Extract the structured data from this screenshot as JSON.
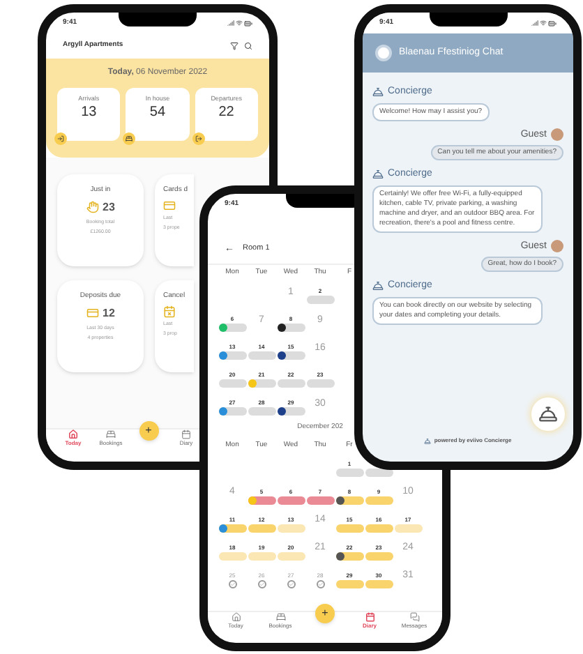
{
  "dashboard_phone": {
    "time": "9:41",
    "title": "Argyll Apartments",
    "date_line": "**Today,** 06 November 2022",
    "stats": [
      {
        "label": "Arrivals",
        "value": "13",
        "kind": "arrivals"
      },
      {
        "label": "In house",
        "value": "54",
        "kind": "inhouse"
      },
      {
        "label": "Departures",
        "value": "22",
        "kind": "departures"
      }
    ],
    "cards": [
      {
        "label": "Just in",
        "value": "23",
        "kind": "justin",
        "line1": "Booking total",
        "line2": "£1260.00"
      },
      {
        "label": "Cards d",
        "kind": "cards",
        "line1": "Last",
        "line2": "3 prope"
      },
      {
        "label": "Deposits due",
        "value": "12",
        "kind": "deposits",
        "line1": "Last 30 days",
        "line2": "4 properties"
      },
      {
        "label": "Cancel",
        "kind": "cancel",
        "line1": "Last",
        "line2": "3 prop"
      }
    ],
    "nav": [
      {
        "label": "Today",
        "kind": "today",
        "selected": true
      },
      {
        "label": "Bookings",
        "kind": "bookings",
        "selected": false
      },
      {
        "label": "Diary",
        "kind": "diary",
        "selected": false
      }
    ],
    "add_button": "+"
  },
  "diary_phone": {
    "time": "9:41",
    "back": "←",
    "title": "Room 1",
    "november": {
      "weekdays": [
        "Mon",
        "Tue",
        "Wed",
        "Thu",
        "F"
      ],
      "weeks": [
        [
          {
            "kind": "blank"
          },
          {
            "kind": "blank"
          },
          {
            "kind": "free",
            "day": "1"
          },
          {
            "kind": "booked",
            "day": "2",
            "color": "#dcdcdc"
          }
        ],
        [
          {
            "kind": "booked",
            "day": "6",
            "color": "#dcdcdc",
            "guest": {
              "color": "#1fbf6a"
            }
          },
          {
            "kind": "free",
            "day": "7"
          },
          {
            "kind": "booked",
            "day": "8",
            "color": "#dcdcdc",
            "guest": {
              "color": "#222222"
            }
          },
          {
            "kind": "free",
            "day": "9"
          }
        ],
        [
          {
            "kind": "booked",
            "day": "13",
            "color": "#dcdcdc",
            "guest": {
              "color": "#2a8fd8"
            }
          },
          {
            "kind": "booked",
            "day": "14",
            "color": "#dcdcdc"
          },
          {
            "kind": "booked",
            "day": "15",
            "color": "#dcdcdc",
            "guest": {
              "color": "#1e3f8a"
            }
          },
          {
            "kind": "free",
            "day": "16"
          }
        ],
        [
          {
            "kind": "booked",
            "day": "20",
            "color": "#dcdcdc"
          },
          {
            "kind": "booked",
            "day": "21",
            "color": "#dcdcdc",
            "guest": {
              "color": "#f5c518"
            }
          },
          {
            "kind": "booked",
            "day": "22",
            "color": "#dcdcdc"
          },
          {
            "kind": "booked",
            "day": "23",
            "color": "#dcdcdc"
          }
        ],
        [
          {
            "kind": "booked",
            "day": "27",
            "color": "#dcdcdc",
            "guest": {
              "color": "#2a8fd8"
            }
          },
          {
            "kind": "booked",
            "day": "28",
            "color": "#dcdcdc"
          },
          {
            "kind": "booked",
            "day": "29",
            "color": "#dcdcdc",
            "guest": {
              "color": "#1e3f8a"
            }
          },
          {
            "kind": "free",
            "day": "30"
          }
        ]
      ]
    },
    "december": {
      "label": "December 202",
      "weekdays": [
        "Mon",
        "Tue",
        "Wed",
        "Thu",
        "Fr"
      ],
      "weeks": [
        [
          {
            "kind": "blank"
          },
          {
            "kind": "blank"
          },
          {
            "kind": "blank"
          },
          {
            "kind": "blank"
          },
          {
            "kind": "booked",
            "day": "1",
            "color": "#dcdcdc"
          },
          {
            "kind": "booked",
            "color": "#dcdcdc"
          },
          {
            "kind": "blank"
          }
        ],
        [
          {
            "kind": "free",
            "day": "4"
          },
          {
            "kind": "booked",
            "day": "5",
            "color": "#e98a95",
            "guest": {
              "color": "#f5c518"
            }
          },
          {
            "kind": "booked",
            "day": "6",
            "color": "#e98a95"
          },
          {
            "kind": "booked",
            "day": "7",
            "color": "#e98a95"
          },
          {
            "kind": "booked",
            "day": "8",
            "color": "#f9d36b",
            "guest": {
              "color": "#555555"
            }
          },
          {
            "kind": "booked",
            "day": "9",
            "color": "#f9d36b"
          },
          {
            "kind": "free",
            "day": "10"
          }
        ],
        [
          {
            "kind": "booked",
            "day": "11",
            "color": "#f9d36b",
            "guest": {
              "color": "#2a8fd8"
            }
          },
          {
            "kind": "booked",
            "day": "12",
            "color": "#f9d36b"
          },
          {
            "kind": "booked",
            "day": "13",
            "color": "#fbe7b3"
          },
          {
            "kind": "free",
            "day": "14"
          },
          {
            "kind": "booked",
            "day": "15",
            "color": "#f9d36b"
          },
          {
            "kind": "booked",
            "day": "16",
            "color": "#f9d36b"
          },
          {
            "kind": "booked",
            "day": "17",
            "color": "#fbe7b3"
          }
        ],
        [
          {
            "kind": "booked",
            "day": "18",
            "color": "#fbe7b3"
          },
          {
            "kind": "booked",
            "day": "19",
            "color": "#fbe7b3"
          },
          {
            "kind": "booked",
            "day": "20",
            "color": "#fbe7b3"
          },
          {
            "kind": "free",
            "day": "21"
          },
          {
            "kind": "booked",
            "day": "22",
            "color": "#f9d36b",
            "guest": {
              "color": "#555555"
            }
          },
          {
            "kind": "booked",
            "day": "23",
            "color": "#f9d36b"
          },
          {
            "kind": "free",
            "day": "24"
          }
        ],
        [
          {
            "kind": "cleaning",
            "day": "25"
          },
          {
            "kind": "cleaning",
            "day": "26"
          },
          {
            "kind": "cleaning",
            "day": "27"
          },
          {
            "kind": "cleaning",
            "day": "28"
          },
          {
            "kind": "booked",
            "day": "29",
            "color": "#f9d36b"
          },
          {
            "kind": "booked",
            "day": "30",
            "color": "#f9d36b"
          },
          {
            "kind": "free",
            "day": "31"
          }
        ]
      ]
    },
    "nav": [
      {
        "label": "Today",
        "kind": "today",
        "selected": false
      },
      {
        "label": "Bookings",
        "kind": "bookings",
        "selected": false
      },
      {
        "label": "Diary",
        "kind": "diary",
        "selected": true
      },
      {
        "label": "Messages",
        "kind": "messages",
        "selected": false
      }
    ],
    "add_button": "+"
  },
  "chat_phone": {
    "time": "9:41",
    "title": "Blaenau Ffestiniog Chat",
    "messages": [
      {
        "kind": "concierge",
        "sender": "Concierge",
        "text": "Welcome! How may I assist you?"
      },
      {
        "kind": "guest",
        "sender": "Guest",
        "text": "Can you tell me about your amenities?"
      },
      {
        "kind": "concierge",
        "sender": "Concierge",
        "text": "Certainly! We offer free Wi-Fi, a fully-equipped kitchen, cable TV, private parking, a washing machine and dryer, and an outdoor BBQ area. For recreation, there's a pool and fitness centre."
      },
      {
        "kind": "guest",
        "sender": "Guest",
        "text": "Great, how do I book?"
      },
      {
        "kind": "concierge",
        "sender": "Concierge",
        "text": "You can book directly on our website by selecting your dates and completing your details."
      }
    ],
    "footer": "powered by eviivo Concierge"
  }
}
